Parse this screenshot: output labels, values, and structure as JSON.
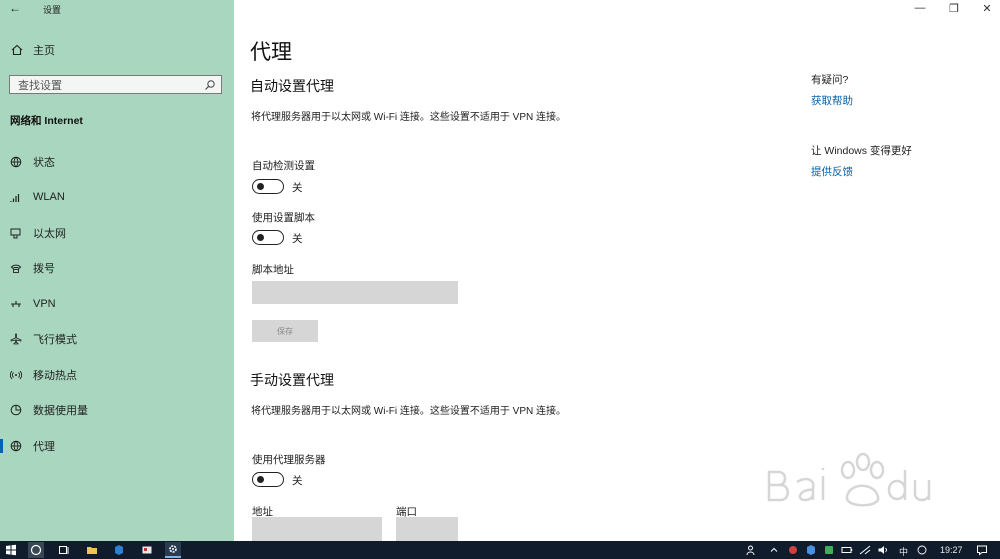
{
  "window": {
    "app_title": "设置",
    "back": "←",
    "minimize": "—",
    "maximize": "❐",
    "close": "✕"
  },
  "sidebar": {
    "home_label": "主页",
    "search_placeholder": "查找设置",
    "section_title": "网络和 Internet",
    "items": [
      {
        "label": "状态",
        "icon": "status-globe-icon"
      },
      {
        "label": "WLAN",
        "icon": "wifi-icon"
      },
      {
        "label": "以太网",
        "icon": "ethernet-icon"
      },
      {
        "label": "拨号",
        "icon": "dialup-icon"
      },
      {
        "label": "VPN",
        "icon": "vpn-icon"
      },
      {
        "label": "飞行模式",
        "icon": "airplane-icon"
      },
      {
        "label": "移动热点",
        "icon": "hotspot-icon"
      },
      {
        "label": "数据使用量",
        "icon": "data-usage-icon"
      },
      {
        "label": "代理",
        "icon": "proxy-globe-icon",
        "active": true
      }
    ]
  },
  "main": {
    "title": "代理",
    "auto": {
      "heading": "自动设置代理",
      "description": "将代理服务器用于以太网或 Wi-Fi 连接。这些设置不适用于 VPN 连接。",
      "detect_label": "自动检测设置",
      "detect_state": "关",
      "script_label": "使用设置脚本",
      "script_state": "关",
      "address_label": "脚本地址",
      "address_value": "",
      "save_label": "保存"
    },
    "manual": {
      "heading": "手动设置代理",
      "description": "将代理服务器用于以太网或 Wi-Fi 连接。这些设置不适用于 VPN 连接。",
      "use_proxy_label": "使用代理服务器",
      "use_proxy_state": "关",
      "address_label": "地址",
      "port_label": "端口"
    }
  },
  "help": {
    "question": "有疑问?",
    "get_help": "获取帮助",
    "improve": "让 Windows 变得更好",
    "feedback": "提供反馈"
  },
  "taskbar": {
    "ime": "中",
    "clock": "19:27"
  },
  "colors": {
    "sidebar_bg": "#a8d6be",
    "accent": "#0063b1",
    "taskbar_bg": "#101c2c"
  }
}
